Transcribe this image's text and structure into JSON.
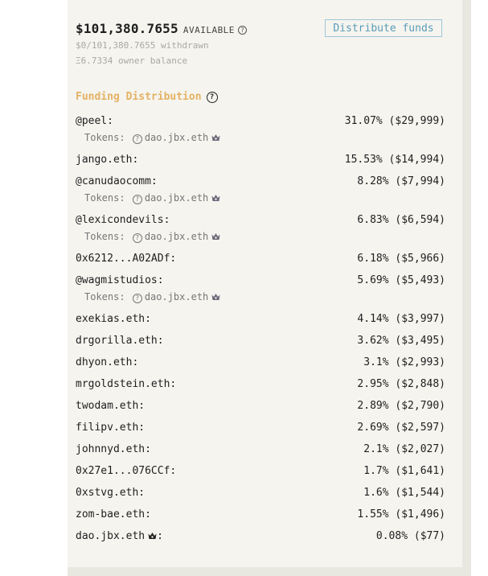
{
  "header": {
    "amount": "$101,380.7655",
    "available_label": "AVAILABLE",
    "withdrawn": "$0/101,380.7655 withdrawn",
    "owner_balance": "Ξ6.7334 owner balance"
  },
  "distribute_button": "Distribute funds",
  "section_title": "Funding Distribution",
  "tokens_label": "Tokens:",
  "tokens_value": "dao.jbx.eth",
  "rows": [
    {
      "name": "@peel:",
      "pct": "31.07% ($29,999)",
      "tokens": true
    },
    {
      "name": "jango.eth:",
      "pct": "15.53% ($14,994)",
      "tokens": false
    },
    {
      "name": "@canudaocomm:",
      "pct": "8.28% ($7,994)",
      "tokens": true
    },
    {
      "name": "@lexicondevils:",
      "pct": "6.83% ($6,594)",
      "tokens": true
    },
    {
      "name": "0x6212...A02ADf:",
      "pct": "6.18% ($5,966)",
      "tokens": false
    },
    {
      "name": "@wagmistudios:",
      "pct": "5.69% ($5,493)",
      "tokens": true
    },
    {
      "name": "exekias.eth:",
      "pct": "4.14% ($3,997)",
      "tokens": false
    },
    {
      "name": "drgorilla.eth:",
      "pct": "3.62% ($3,495)",
      "tokens": false
    },
    {
      "name": "dhyon.eth:",
      "pct": "3.1% ($2,993)",
      "tokens": false
    },
    {
      "name": "mrgoldstein.eth:",
      "pct": "2.95% ($2,848)",
      "tokens": false
    },
    {
      "name": "twodam.eth:",
      "pct": "2.89% ($2,790)",
      "tokens": false
    },
    {
      "name": "filipv.eth:",
      "pct": "2.69% ($2,597)",
      "tokens": false
    },
    {
      "name": "johnnyd.eth:",
      "pct": "2.1% ($2,027)",
      "tokens": false
    },
    {
      "name": "0x27e1...076CCf:",
      "pct": "1.7% ($1,641)",
      "tokens": false
    },
    {
      "name": "0xstvg.eth:",
      "pct": "1.6% ($1,544)",
      "tokens": false
    },
    {
      "name": "zom-bae.eth:",
      "pct": "1.55% ($1,496)",
      "tokens": false
    }
  ],
  "owner_row": {
    "name": "dao.jbx.eth",
    "suffix": ":",
    "pct": "0.08% ($77)"
  }
}
